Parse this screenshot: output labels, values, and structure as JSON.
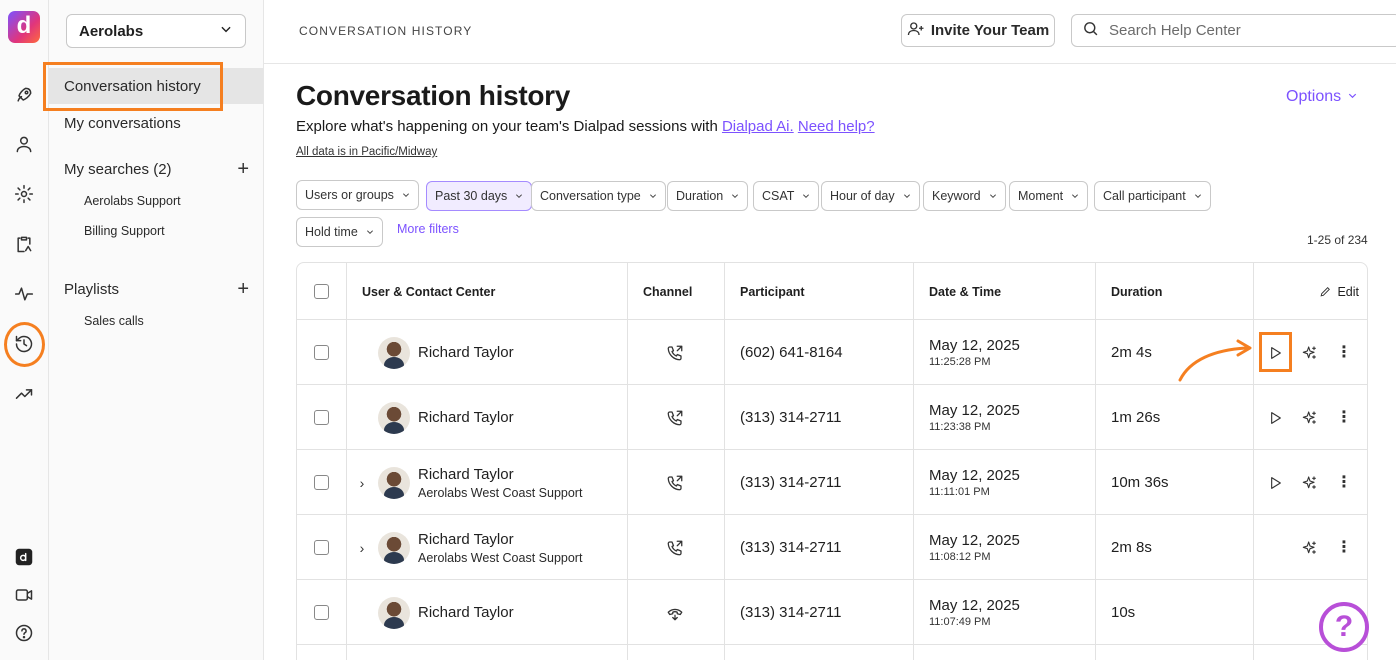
{
  "workspace": {
    "name": "Aerolabs"
  },
  "sidebar": {
    "items": [
      {
        "label": "Conversation history"
      },
      {
        "label": "My conversations"
      }
    ],
    "my_searches": {
      "label": "My searches (2)",
      "items": [
        "Aerolabs Support",
        "Billing Support"
      ]
    },
    "playlists": {
      "label": "Playlists",
      "items": [
        "Sales calls"
      ]
    }
  },
  "topbar": {
    "breadcrumb": "CONVERSATION HISTORY",
    "invite_label": "Invite Your Team",
    "search_placeholder": "Search Help Center"
  },
  "page": {
    "title": "Conversation history",
    "options_label": "Options",
    "subtitle_prefix": "Explore what's happening on your team's Dialpad sessions with",
    "subtitle_link1": "Dialpad Ai.",
    "subtitle_link2": "Need help?",
    "timezone_note": "All data is in Pacific/Midway"
  },
  "filters": [
    {
      "label": "Users or groups",
      "active": false
    },
    {
      "label": "Past 30 days",
      "active": true
    },
    {
      "label": "Conversation type",
      "active": false
    },
    {
      "label": "Duration",
      "active": false
    },
    {
      "label": "CSAT",
      "active": false
    },
    {
      "label": "Hour of day",
      "active": false
    },
    {
      "label": "Keyword",
      "active": false
    },
    {
      "label": "Moment",
      "active": false
    },
    {
      "label": "Call participant",
      "active": false
    },
    {
      "label": "Hold time",
      "active": false
    }
  ],
  "more_filters_label": "More filters",
  "result_count": "1-25 of 234",
  "table": {
    "columns": [
      "User & Contact Center",
      "Channel",
      "Participant",
      "Date & Time",
      "Duration"
    ],
    "edit_label": "Edit",
    "rows": [
      {
        "user": "Richard Taylor",
        "contact_center": "",
        "expandable": false,
        "channel_icon": "outgoing-call-icon",
        "participant": "(602) 641-8164",
        "date": "May 12, 2025",
        "time": "11:25:28 PM",
        "duration": "2m 4s",
        "actions": [
          "play",
          "ai",
          "more"
        ]
      },
      {
        "user": "Richard Taylor",
        "contact_center": "",
        "expandable": false,
        "channel_icon": "outgoing-call-icon",
        "participant": "(313) 314-2711",
        "date": "May 12, 2025",
        "time": "11:23:38 PM",
        "duration": "1m 26s",
        "actions": [
          "play",
          "ai",
          "more"
        ]
      },
      {
        "user": "Richard Taylor",
        "contact_center": "Aerolabs West Coast Support",
        "expandable": true,
        "channel_icon": "outgoing-call-icon",
        "participant": "(313) 314-2711",
        "date": "May 12, 2025",
        "time": "11:11:01 PM",
        "duration": "10m 36s",
        "actions": [
          "play",
          "ai",
          "more"
        ]
      },
      {
        "user": "Richard Taylor",
        "contact_center": "Aerolabs West Coast Support",
        "expandable": true,
        "channel_icon": "outgoing-call-icon",
        "participant": "(313) 314-2711",
        "date": "May 12, 2025",
        "time": "11:08:12 PM",
        "duration": "2m 8s",
        "actions": [
          "ai",
          "more"
        ]
      },
      {
        "user": "Richard Taylor",
        "contact_center": "",
        "expandable": false,
        "channel_icon": "missed-call-icon",
        "participant": "(313) 314-2711",
        "date": "May 12, 2025",
        "time": "11:07:49 PM",
        "duration": "10s",
        "actions": []
      }
    ]
  },
  "help_fab_label": "?",
  "logo_letter": "d",
  "colors": {
    "accent": "#7c52ff",
    "highlight": "#f57f20",
    "help": "#b84fd8"
  }
}
